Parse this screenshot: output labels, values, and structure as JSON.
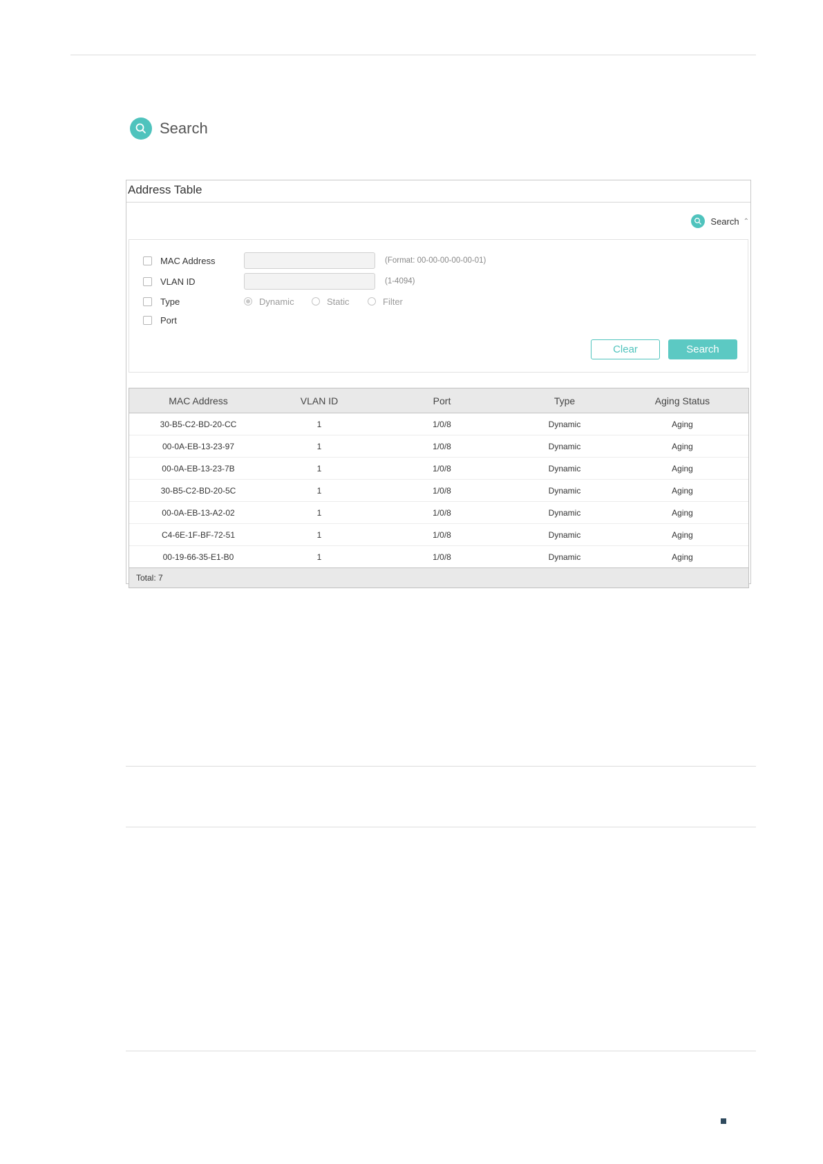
{
  "section": {
    "title": "Search",
    "icon": "search-icon"
  },
  "panel": {
    "title": "Address Table",
    "search_toggle": {
      "label": "Search",
      "icon": "search-icon",
      "state_icon": "chevron-up-icon"
    },
    "filters": {
      "mac": {
        "label": "MAC Address",
        "value": "",
        "hint": "(Format: 00-00-00-00-00-01)"
      },
      "vlan": {
        "label": "VLAN ID",
        "value": "",
        "hint": "(1-4094)"
      },
      "type": {
        "label": "Type",
        "options": [
          "Dynamic",
          "Static",
          "Filter"
        ],
        "selected": "Dynamic"
      },
      "port": {
        "label": "Port"
      }
    },
    "buttons": {
      "clear": "Clear",
      "search": "Search"
    }
  },
  "table": {
    "columns": [
      "MAC Address",
      "VLAN ID",
      "Port",
      "Type",
      "Aging Status"
    ],
    "rows": [
      [
        "30-B5-C2-BD-20-CC",
        "1",
        "1/0/8",
        "Dynamic",
        "Aging"
      ],
      [
        "00-0A-EB-13-23-97",
        "1",
        "1/0/8",
        "Dynamic",
        "Aging"
      ],
      [
        "00-0A-EB-13-23-7B",
        "1",
        "1/0/8",
        "Dynamic",
        "Aging"
      ],
      [
        "30-B5-C2-BD-20-5C",
        "1",
        "1/0/8",
        "Dynamic",
        "Aging"
      ],
      [
        "00-0A-EB-13-A2-02",
        "1",
        "1/0/8",
        "Dynamic",
        "Aging"
      ],
      [
        "C4-6E-1F-BF-72-51",
        "1",
        "1/0/8",
        "Dynamic",
        "Aging"
      ],
      [
        "00-19-66-35-E1-B0",
        "1",
        "1/0/8",
        "Dynamic",
        "Aging"
      ]
    ],
    "total": "Total: 7"
  },
  "colors": {
    "accent": "#4fc3bd",
    "header_bg": "#e9e9e9"
  }
}
